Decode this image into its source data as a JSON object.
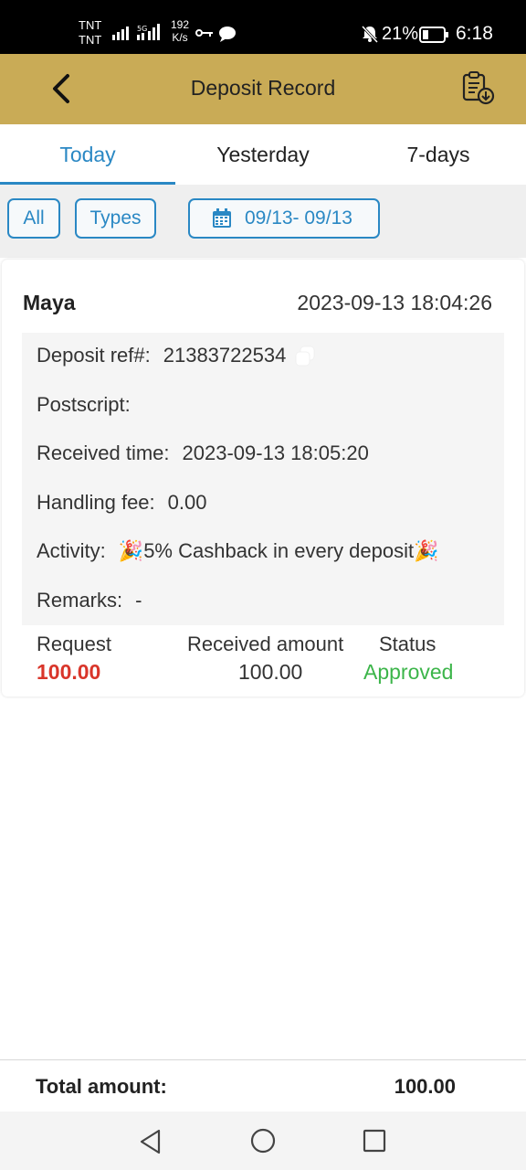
{
  "status_bar": {
    "carrier1": "TNT",
    "carrier2": "TNT",
    "net_speed_value": "192",
    "net_speed_unit": "K/s",
    "battery": "21%",
    "time": "6:18"
  },
  "header": {
    "title": "Deposit Record",
    "back_icon": "chevron-left-icon",
    "right_icon": "clipboard-download-icon"
  },
  "tabs": [
    {
      "label": "Today",
      "active": true
    },
    {
      "label": "Yesterday",
      "active": false
    },
    {
      "label": "7-days",
      "active": false
    }
  ],
  "filters": {
    "all_label": "All",
    "types_label": "Types",
    "date_range": "09/13- 09/13"
  },
  "record": {
    "method": "Maya",
    "datetime": "2023-09-13 18:04:26",
    "details": {
      "ref_label": "Deposit ref#:",
      "ref_value": "21383722534",
      "postscript_label": "Postscript:",
      "postscript_value": "",
      "received_time_label": "Received time:",
      "received_time_value": "2023-09-13 18:05:20",
      "fee_label": "Handling fee:",
      "fee_value": "0.00",
      "activity_label": "Activity:",
      "activity_value": "🎉5% Cashback in every deposit🎉",
      "remarks_label": "Remarks:",
      "remarks_value": "-"
    },
    "request_label": "Request",
    "request_value": "100.00",
    "received_label": "Received amount",
    "received_value": "100.00",
    "status_label": "Status",
    "status_value": "Approved"
  },
  "footer": {
    "total_label": "Total amount:",
    "total_value": "100.00"
  },
  "colors": {
    "header_bg": "#c9ab56",
    "accent": "#2a88c4",
    "request_red": "#d9352a",
    "approved_green": "#3cb54a"
  }
}
